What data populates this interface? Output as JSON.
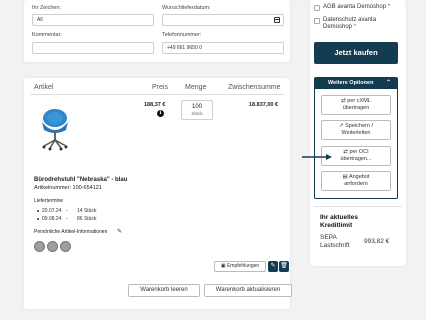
{
  "form": {
    "field1_label": "Ihr Zeichen:",
    "field1_value": "All",
    "date_label": "Wunschlieferdatum:",
    "comment_label": "Kommentar:",
    "phone_label": "Telefonnummer:",
    "phone_value": "+49 661 9650 0"
  },
  "cart": {
    "headers": {
      "article": "Artikel",
      "price": "Preis",
      "qty": "Menge",
      "subtotal": "Zwischensumme"
    },
    "item": {
      "price": "188,37 €",
      "qty": "100",
      "unit": "Stück",
      "subtotal": "18.837,00 €",
      "name": "Bürodrehstuhl \"Nebraska\" - blau",
      "article_no": "Artikelnummer: 100-654121",
      "delivery_title": "Liefertermine",
      "delivery_dates": [
        {
          "date": "20.07.24",
          "sep": "-",
          "qty": "14 Stück"
        },
        {
          "date": "09.08.24",
          "sep": "-",
          "qty": "86 Stück"
        }
      ],
      "personal_info": "Persönliche Artikel-Informationen",
      "recommend_label": "Empfehlungen"
    },
    "buttons": {
      "clear": "Warenkorb leeren",
      "update": "Warenkorb aktualisieren"
    }
  },
  "sidebar": {
    "agb": "AGB avanta Demoshop",
    "agb_star": "*",
    "privacy_line1": "Datenschutz avanta",
    "privacy_line2": "Demoshop",
    "privacy_star": "*",
    "buy": "Jetzt kaufen",
    "more_options": "Weitere Optionen",
    "options": [
      {
        "icon": "exchange-icon",
        "line1": "per cXML",
        "line2": "übertragen"
      },
      {
        "icon": "share-icon",
        "line1": "Speichern /",
        "line2": "Weiterleiten"
      },
      {
        "icon": "exchange-icon",
        "line1": "per OCI",
        "line2": "übertragen..."
      },
      {
        "icon": "document-icon",
        "line1": "Angebot",
        "line2": "anfordern"
      }
    ],
    "credit_title_line1": "Ihr aktuelles",
    "credit_title_line2": "Kreditlimit",
    "credit_method_line1": "SEPA",
    "credit_method_line2": "Lastschrift",
    "credit_amount": "993,82 €"
  },
  "colors": {
    "primary": "#143c50",
    "background": "#f2f2f2",
    "required": "#c0392b"
  }
}
